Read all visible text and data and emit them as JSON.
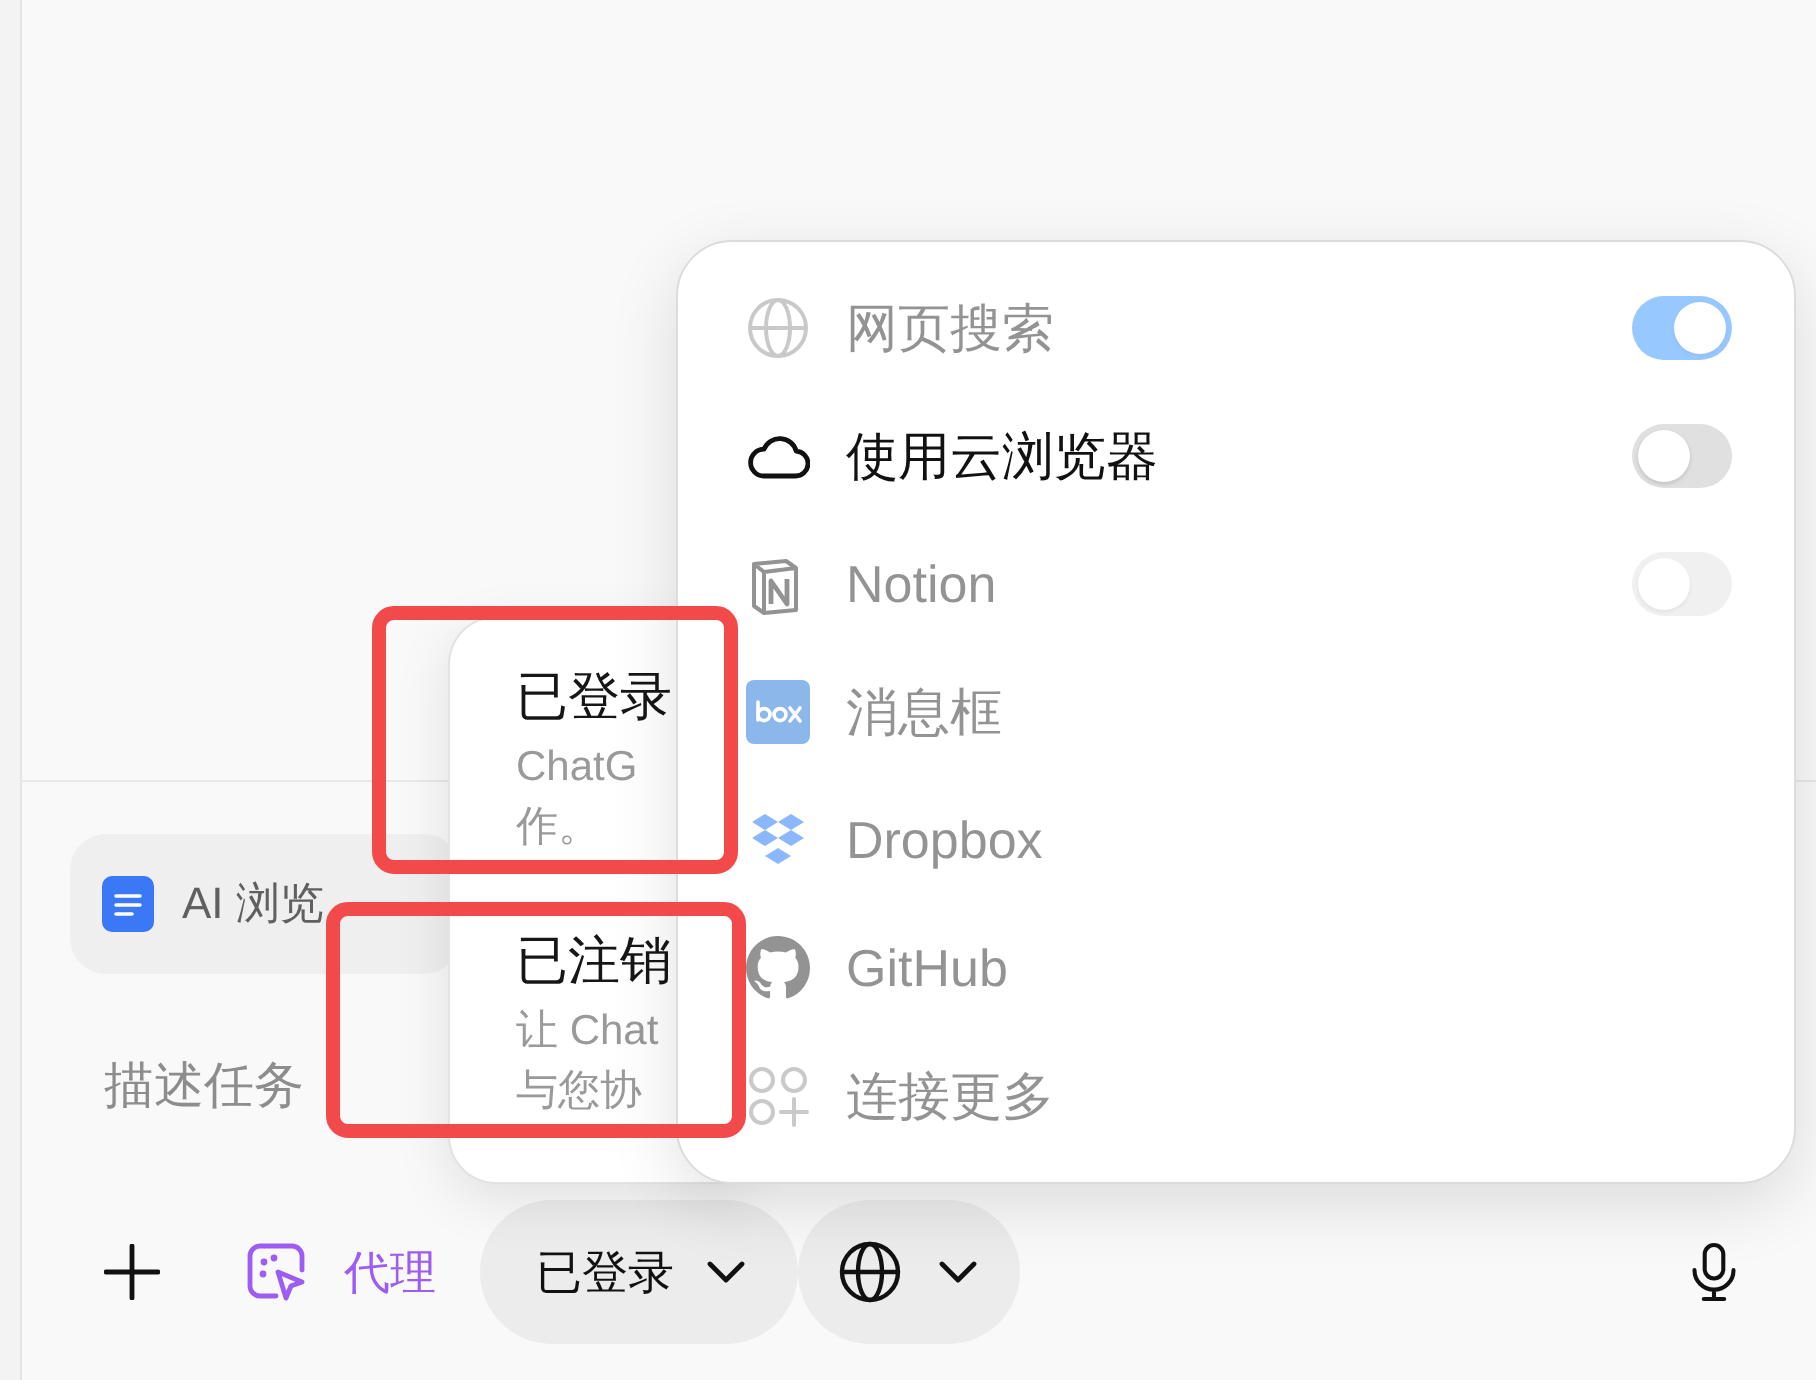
{
  "composer": {
    "attachment": {
      "label": "AI 浏览"
    },
    "input": {
      "placeholder": "描述任务"
    }
  },
  "toolbar": {
    "agent": {
      "label": "代理"
    },
    "account_mode": {
      "label": "已登录"
    }
  },
  "account_menu": {
    "options": [
      {
        "title": "已登录",
        "description_lines": [
          "ChatG",
          "作。"
        ],
        "highlighted": true
      },
      {
        "title": "已注销",
        "description_lines": [
          "让 Chat",
          "与您协"
        ],
        "highlighted": true
      }
    ]
  },
  "tools_menu": {
    "items": [
      {
        "kind": "toggle",
        "label": "网页搜索",
        "on": true,
        "disabled": true
      },
      {
        "kind": "toggle",
        "label": "使用云浏览器",
        "on": false,
        "disabled": false
      },
      {
        "kind": "toggle",
        "label": "Notion",
        "on": false,
        "disabled": true
      },
      {
        "kind": "plain",
        "label": "消息框",
        "disabled": true
      },
      {
        "kind": "plain",
        "label": "Dropbox",
        "disabled": true
      },
      {
        "kind": "plain",
        "label": "GitHub",
        "disabled": true
      },
      {
        "kind": "plain",
        "label": "连接更多",
        "disabled": true
      }
    ]
  }
}
